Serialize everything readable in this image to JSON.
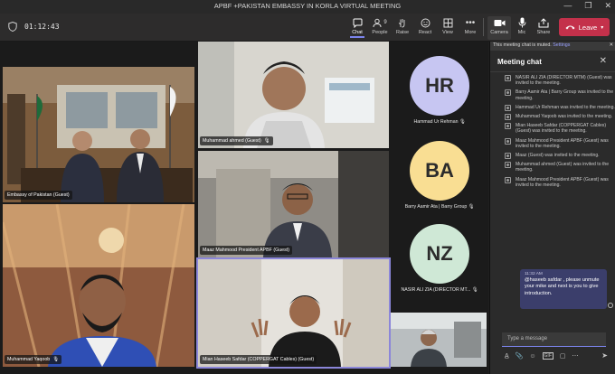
{
  "window": {
    "title": "APBF +PAKISTAN EMBASSY IN KORLA VIRTUAL MEETING",
    "minimize": "—",
    "restore": "❐",
    "close": "✕"
  },
  "toolbar": {
    "timer": "01:12:43",
    "chat_label": "Chat",
    "people_label": "People",
    "people_count": "9",
    "raise_label": "Raise",
    "react_label": "React",
    "view_label": "View",
    "more_label": "More",
    "camera_label": "Camera",
    "mic_label": "Mic",
    "share_label": "Share",
    "leave_label": "Leave"
  },
  "participants": {
    "embassy": {
      "name": "Embassy of Pakistan (Guest)"
    },
    "muhammad_ahmed": {
      "name": "Muhammad ahmed (Guest)"
    },
    "maaz": {
      "name": "Maaz Mahmood President APBF (Guest)"
    },
    "yaqoob": {
      "name": "Muhammad Yaqoob"
    },
    "haseeb": {
      "name": "Mian Haseeb Safdar (COPPERGAT Cables) (Guest)"
    },
    "hr": {
      "initials": "HR",
      "name": "Hammad Ur Rehman",
      "color": "#c7c6f2"
    },
    "ba": {
      "initials": "BA",
      "name": "Barry Aamir Ata | Barry Group",
      "color": "#f9de93"
    },
    "nz": {
      "initials": "NZ",
      "name": "NASIR ALI ZIA (DIRECTOR MT...",
      "color": "#cfe8d6"
    }
  },
  "chat": {
    "muted_text": "This meeting chat is muted.",
    "muted_link": "Settings",
    "header": "Meeting chat",
    "events": [
      "NASIR ALI ZIA (DIRECTOR MTM) (Guest) was invited to the meeting.",
      "Barry Aamir Ata | Barry Group was invited to the meeting.",
      "Hammad Ur Rehman was invited to the meeting.",
      "Muhammad Yaqoob was invited to the meeting.",
      "Mian Haseeb Safdar (COPPERGAT Cables) (Guest) was invited to the meeting.",
      "Maaz Mahmood President APBF (Guest) was invited to the meeting.",
      "Maaz (Guest) was invited to the meeting.",
      "Muhammad ahmed (Guest) was invited to the meeting.",
      "Maaz Mahmood President APBF (Guest) was invited to the meeting."
    ],
    "message": {
      "time": "11:32 AM",
      "text": "@haseeb safdar , please unmute your mike and next is you to give introduction."
    },
    "compose_placeholder": "Type a message"
  },
  "colors": {
    "accent": "#7b83eb",
    "leave": "#c4314b"
  }
}
